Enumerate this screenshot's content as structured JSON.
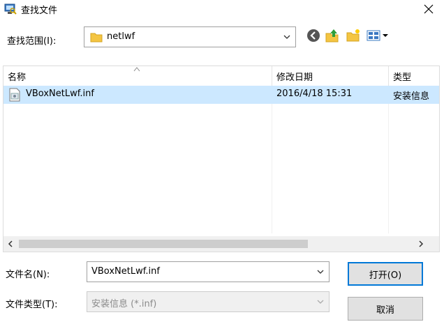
{
  "window": {
    "title": "查找文件"
  },
  "toolbar": {
    "look_in_label": "查找范围(I):",
    "look_in_value": "netlwf"
  },
  "file_list": {
    "columns": [
      "名称",
      "修改日期",
      "类型"
    ],
    "rows": [
      {
        "name": "VBoxNetLwf.inf",
        "modified": "2016/4/18 15:31",
        "type": "安装信息"
      }
    ]
  },
  "filename": {
    "label": "文件名(N):",
    "value": "VBoxNetLwf.inf"
  },
  "filetype": {
    "label": "文件类型(T):",
    "value": "安装信息 (*.inf)"
  },
  "buttons": {
    "open": "打开(O)",
    "cancel": "取消"
  },
  "colors": {
    "selection": "#cce8ff",
    "accent": "#0078d7",
    "folder": "#f4c542"
  }
}
